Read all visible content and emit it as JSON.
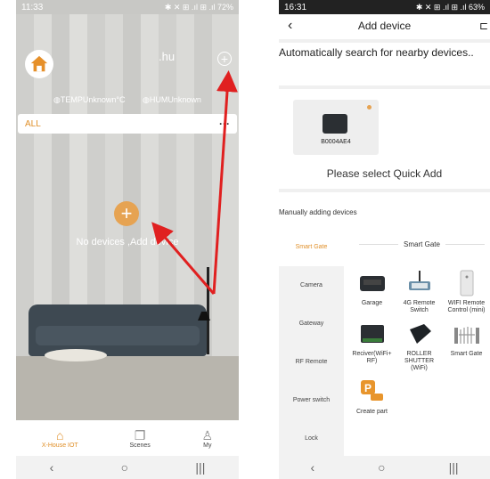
{
  "left": {
    "status": {
      "time": "11:33",
      "icons": "✱ ✕ ⊞ .ıl ⊞ .ıl 72%"
    },
    "username": ".hu",
    "temp": "TEMPUnknown°C",
    "hum": "HUMUnknown",
    "group_label": "ALL",
    "group_menu": "···",
    "empty_text": "No devices ,Add device",
    "nav": [
      {
        "label": "X-House IOT",
        "icon": "home-icon"
      },
      {
        "label": "Scenes",
        "icon": "scenes-icon"
      },
      {
        "label": "My",
        "icon": "person-icon"
      }
    ],
    "sysnav": [
      "‹",
      "○",
      "|||"
    ]
  },
  "right": {
    "status": {
      "time": "16:31",
      "icons": "✱ ✕ ⊞ .ıl ⊞ .ıl 63%"
    },
    "title": "Add device",
    "auto_search": "Automatically search for nearby devices..",
    "found_device": "B0004AE4",
    "quick_add": "Please select Quick Add",
    "manual": "Manually adding devices",
    "categories": [
      "Smart Gate",
      "Camera",
      "Gateway",
      "RF Remote",
      "Power switch",
      "Lock"
    ],
    "section_title": "Smart Gate",
    "devices": [
      {
        "label": "Garage",
        "icon": "garage-controller-icon"
      },
      {
        "label": "4G Remote Switch",
        "icon": "4g-switch-icon"
      },
      {
        "label": "WIFI Remote Control (mini)",
        "icon": "remote-icon"
      },
      {
        "label": "Reciver(WiFi+ RF)",
        "icon": "receiver-icon"
      },
      {
        "label": "ROLLER SHUTTER (WiFi)",
        "icon": "roller-shutter-icon"
      },
      {
        "label": "Smart Gate",
        "icon": "gate-icon"
      },
      {
        "label": "Create part",
        "icon": "parking-icon"
      }
    ],
    "sysnav": [
      "‹",
      "○",
      "|||"
    ]
  },
  "colors": {
    "accent": "#e0902a",
    "button": "#e6a352",
    "arrow": "#e02020"
  }
}
